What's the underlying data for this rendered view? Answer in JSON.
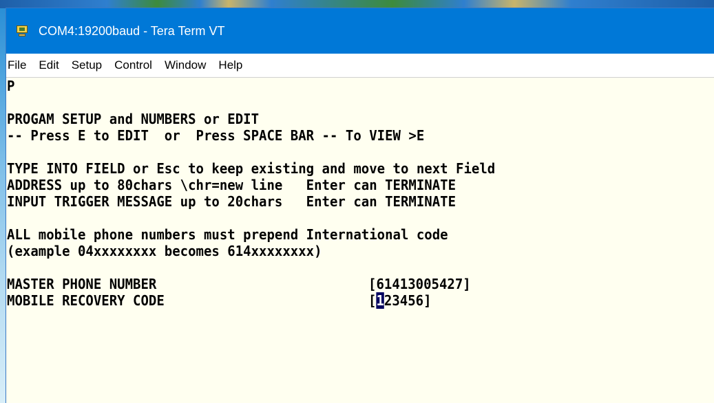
{
  "window": {
    "title": "COM4:19200baud - Tera Term VT"
  },
  "menu": [
    "File",
    "Edit",
    "Setup",
    "Control",
    "Window",
    "Help"
  ],
  "terminal": {
    "lines": [
      "P",
      "",
      "PROGAM SETUP and NUMBERS or EDIT",
      "-- Press E to EDIT  or  Press SPACE BAR -- To VIEW >E",
      "",
      "TYPE INTO FIELD or Esc to keep existing and move to next Field",
      "ADDRESS up to 80chars \\chr=new line   Enter can TERMINATE",
      "INPUT TRIGGER MESSAGE up to 20chars   Enter can TERMINATE",
      "",
      "ALL mobile phone numbers must prepend International code",
      "(example 04xxxxxxxx becomes 614xxxxxxxx)",
      "",
      "MASTER PHONE NUMBER",
      "MOBILE RECOVERY CODE"
    ],
    "master_phone_value": "[61413005427]",
    "recovery_open_bracket": "[",
    "recovery_cursor_char": "1",
    "recovery_rest": "23456]"
  }
}
